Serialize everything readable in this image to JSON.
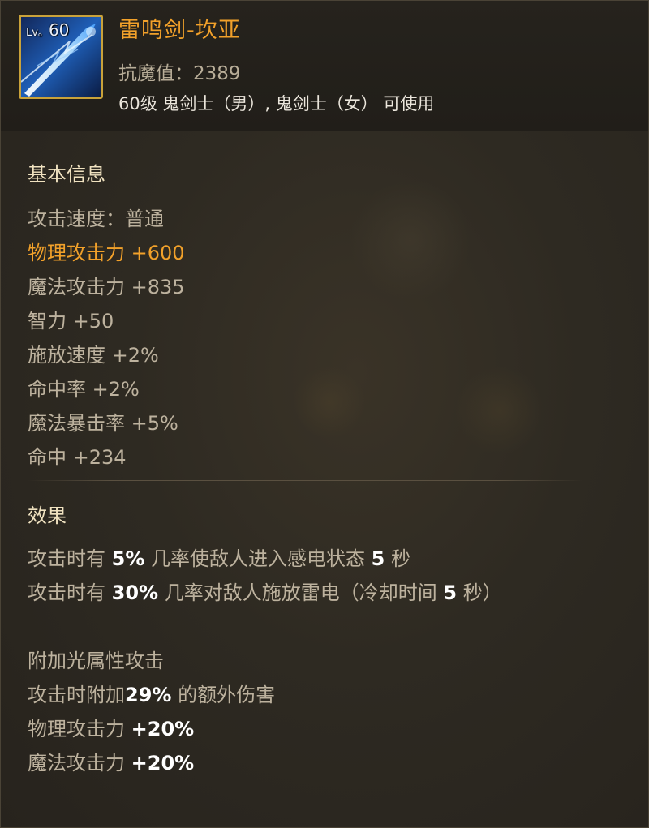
{
  "item": {
    "level_prefix": "Lv。",
    "level": "60",
    "name": "雷鸣剑-坎亚",
    "anti_magic": "抗魔值：2389",
    "usable": "60级 鬼剑士（男）, 鬼剑士（女） 可使用"
  },
  "basic_info": {
    "title": "基本信息",
    "lines": [
      "攻击速度：普通",
      "物理攻击力 +600",
      "魔法攻击力 +835",
      "智力 +50",
      "施放速度 +2%",
      "命中率 +2%",
      "魔法暴击率 +5%",
      "命中 +234"
    ]
  },
  "effects": {
    "title": "效果",
    "line1": {
      "a": "攻击时有 ",
      "b": "5%",
      "c": " 几率使敌人进入感电状态 ",
      "d": "5",
      "e": " 秒"
    },
    "line2": {
      "a": "攻击时有 ",
      "b": "30%",
      "c": " 几率对敌人施放雷电（冷却时间 ",
      "d": "5",
      "e": " 秒）"
    },
    "extra_title": "附加光属性攻击",
    "line3": {
      "a": "攻击时附加",
      "b": "29%",
      "c": " 的额外伤害"
    },
    "line4": {
      "a": "物理攻击力 ",
      "b": "+20%"
    },
    "line5": {
      "a": "魔法攻击力 ",
      "b": "+20%"
    }
  },
  "colors": {
    "accent_orange": "#f2a12a",
    "frame_gold": "#c9a23a",
    "background": "#2e2a22"
  },
  "icon": "lightning-sword-icon"
}
